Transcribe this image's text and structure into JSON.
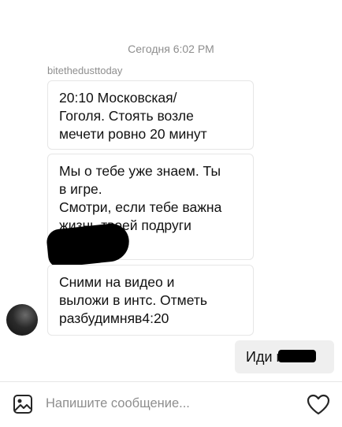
{
  "thread": {
    "timestamp": "Сегодня 6:02 PM",
    "sender": "bitethedusttoday",
    "incoming": [
      {
        "text": "20:10 Московская/\nГоголя. Стоять возле\nмечети ровно 20 минут"
      },
      {
        "text": "Мы о тебе уже знаем. Ты\nв игре.\nСмотри, если тебе важна\nжизнь твоей подруги"
      },
      {
        "text": "Сними на видео и\nвыложи в интс. Отметь\nразбудимняв4:20"
      }
    ],
    "outgoing": [
      {
        "text": "Иди на   !"
      }
    ]
  },
  "composer": {
    "placeholder": "Напишите сообщение...",
    "gallery_icon": "image-icon",
    "like_icon": "heart-icon"
  }
}
